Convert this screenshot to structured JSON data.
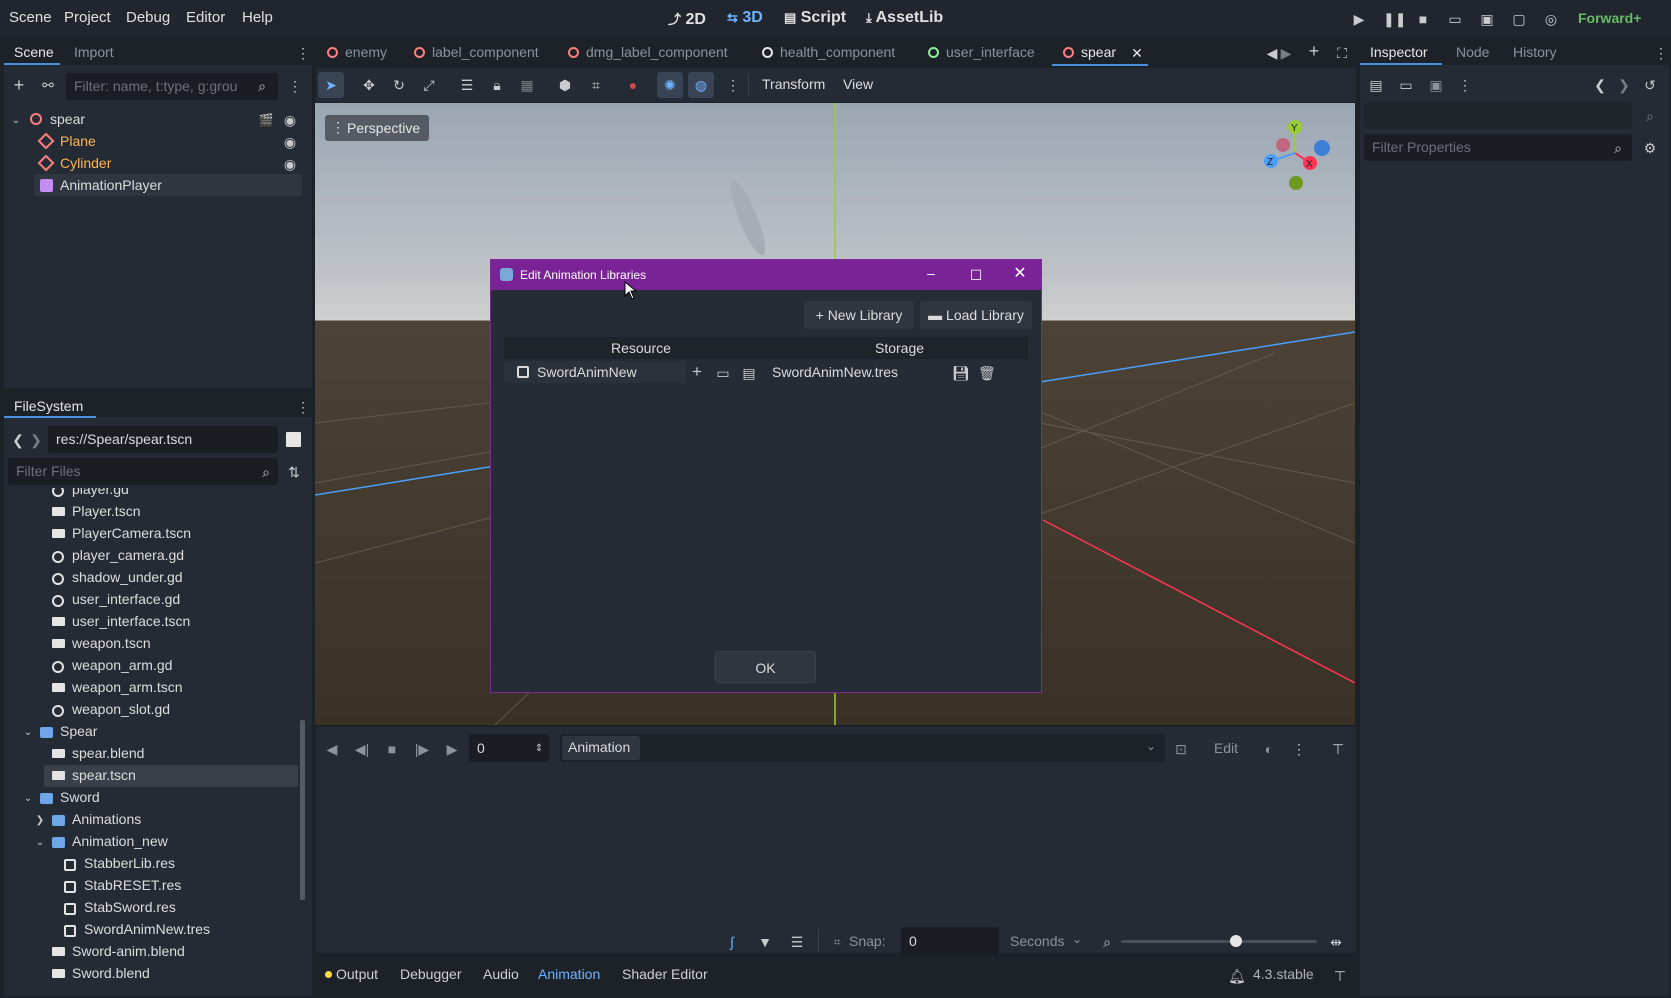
{
  "menu": [
    "Scene",
    "Project",
    "Debug",
    "Editor",
    "Help"
  ],
  "workspaces": [
    "2D",
    "3D",
    "Script",
    "AssetLib"
  ],
  "renderer": "Forward+",
  "scene_dock": {
    "tabs": [
      "Scene",
      "Import"
    ],
    "filter_placeholder": "Filter: name, t:type, g:grou",
    "tree": [
      {
        "label": "spear",
        "color": "#e6e6e6"
      },
      {
        "label": "Plane",
        "color": "#ffb64d"
      },
      {
        "label": "Cylinder",
        "color": "#ffb64d"
      },
      {
        "label": "AnimationPlayer",
        "color": "#e6e6e6"
      }
    ]
  },
  "filesystem": {
    "title": "FileSystem",
    "path": "res://Spear/spear.tscn",
    "filter_placeholder": "Filter Files",
    "rows": [
      {
        "label": "player.gd",
        "icon": "gear"
      },
      {
        "label": "Player.tscn",
        "icon": "scene"
      },
      {
        "label": "PlayerCamera.tscn",
        "icon": "scene"
      },
      {
        "label": "player_camera.gd",
        "icon": "gear"
      },
      {
        "label": "shadow_under.gd",
        "icon": "gear"
      },
      {
        "label": "user_interface.gd",
        "icon": "gear"
      },
      {
        "label": "user_interface.tscn",
        "icon": "scene"
      },
      {
        "label": "weapon.tscn",
        "icon": "scene"
      },
      {
        "label": "weapon_arm.gd",
        "icon": "gear"
      },
      {
        "label": "weapon_arm.tscn",
        "icon": "scene"
      },
      {
        "label": "weapon_slot.gd",
        "icon": "gear"
      },
      {
        "label": "Spear",
        "icon": "folder"
      },
      {
        "label": "spear.blend",
        "icon": "scene"
      },
      {
        "label": "spear.tscn",
        "icon": "scene"
      },
      {
        "label": "Sword",
        "icon": "folder"
      },
      {
        "label": "Animations",
        "icon": "folder"
      },
      {
        "label": "Animation_new",
        "icon": "folder"
      },
      {
        "label": "StabberLib.res",
        "icon": "res"
      },
      {
        "label": "StabRESET.res",
        "icon": "res"
      },
      {
        "label": "StabSword.res",
        "icon": "res"
      },
      {
        "label": "SwordAnimNew.tres",
        "icon": "res"
      },
      {
        "label": "Sword-anim.blend",
        "icon": "scene"
      },
      {
        "label": "Sword.blend",
        "icon": "scene"
      }
    ]
  },
  "scene_tabs": [
    "enemy",
    "label_component",
    "dmg_label_component",
    "health_component",
    "user_interface",
    "spear"
  ],
  "toolbar": {
    "transform": "Transform",
    "view": "View"
  },
  "viewport": {
    "perspective": "Perspective"
  },
  "gizmo": {
    "x": "X",
    "y": "Y",
    "z": "Z"
  },
  "dialog": {
    "title": "Edit Animation Libraries",
    "new_library": "New Library",
    "load_library": "Load Library",
    "col_resource": "Resource",
    "col_storage": "Storage",
    "library_name": "SwordAnimNew",
    "library_storage": "SwordAnimNew.tres",
    "ok": "OK"
  },
  "animation_panel": {
    "time_value": "0",
    "animation_select": "Animation",
    "edit": "Edit",
    "snap_label": "Snap:",
    "snap_value": "0",
    "snap_unit": "Seconds"
  },
  "bottom_tabs": [
    "Output",
    "Debugger",
    "Audio",
    "Animation",
    "Shader Editor"
  ],
  "version": "4.3.stable",
  "inspector": {
    "tabs": [
      "Inspector",
      "Node",
      "History"
    ],
    "filter_placeholder": "Filter Properties"
  }
}
